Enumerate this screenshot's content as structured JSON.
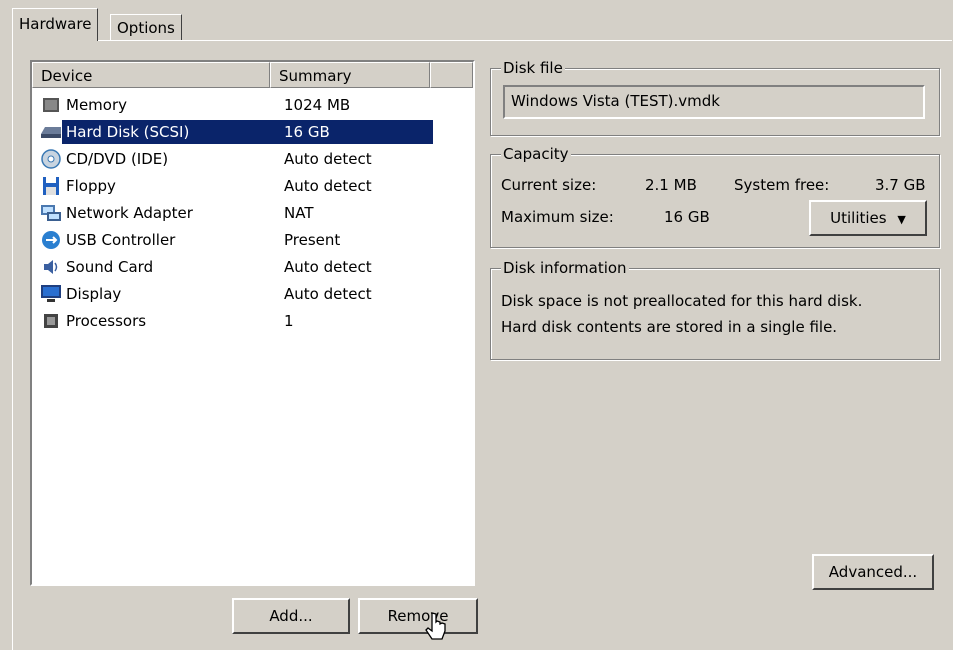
{
  "tabs": [
    {
      "label": "Hardware",
      "active": true
    },
    {
      "label": "Options",
      "active": false
    }
  ],
  "device_list": {
    "columns": [
      "Device",
      "Summary"
    ],
    "rows": [
      {
        "icon": "memory-icon",
        "device": "Memory",
        "summary": "1024 MB",
        "selected": false
      },
      {
        "icon": "hard-disk-icon",
        "device": "Hard Disk (SCSI)",
        "summary": "16 GB",
        "selected": true
      },
      {
        "icon": "cd-dvd-icon",
        "device": "CD/DVD (IDE)",
        "summary": "Auto detect",
        "selected": false
      },
      {
        "icon": "floppy-icon",
        "device": "Floppy",
        "summary": "Auto detect",
        "selected": false
      },
      {
        "icon": "network-adapter-icon",
        "device": "Network Adapter",
        "summary": "NAT",
        "selected": false
      },
      {
        "icon": "usb-icon",
        "device": "USB Controller",
        "summary": "Present",
        "selected": false
      },
      {
        "icon": "sound-card-icon",
        "device": "Sound Card",
        "summary": "Auto detect",
        "selected": false
      },
      {
        "icon": "display-icon",
        "device": "Display",
        "summary": "Auto detect",
        "selected": false
      },
      {
        "icon": "processor-icon",
        "device": "Processors",
        "summary": "1",
        "selected": false
      }
    ]
  },
  "buttons": {
    "add": "Add...",
    "remove": "Remove",
    "utilities": "Utilities",
    "advanced": "Advanced..."
  },
  "disk_file": {
    "legend": "Disk file",
    "value": "Windows Vista (TEST).vmdk"
  },
  "capacity": {
    "legend": "Capacity",
    "current_size_label": "Current size:",
    "current_size_value": "2.1 MB",
    "system_free_label": "System free:",
    "system_free_value": "3.7 GB",
    "maximum_size_label": "Maximum size:",
    "maximum_size_value": "16 GB"
  },
  "disk_information": {
    "legend": "Disk information",
    "line1": "Disk space is not preallocated for this hard disk.",
    "line2": "Hard disk contents are stored in a single file."
  },
  "colors": {
    "face": "#d4d0c8",
    "selection": "#0a246a"
  }
}
